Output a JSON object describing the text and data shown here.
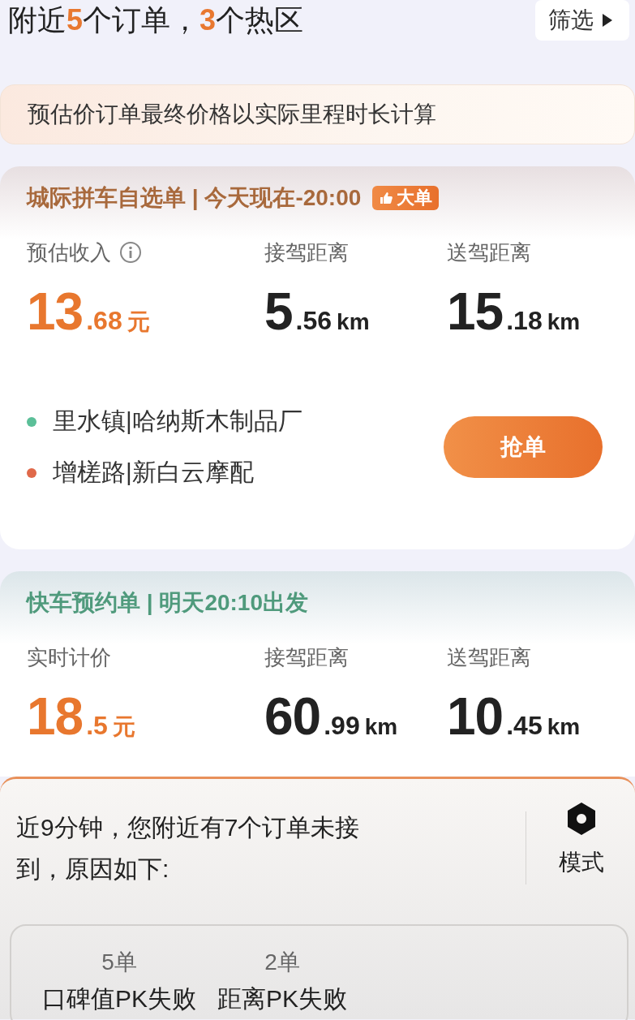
{
  "header": {
    "title_parts": [
      {
        "text": "附近",
        "highlight": false
      },
      {
        "text": "5",
        "highlight": true
      },
      {
        "text": "个订单，",
        "highlight": false
      },
      {
        "text": "3",
        "highlight": true
      },
      {
        "text": "个热区",
        "highlight": false
      }
    ],
    "filter_button": "筛选"
  },
  "notice": "预估价订单最终价格以实际里程时长计算",
  "cards": [
    {
      "title": "城际拼车自选单 | 今天现在-20:00",
      "color": "#a8693c",
      "badge": "大单",
      "stats": [
        {
          "label": "预估收入",
          "info": true,
          "accent": true,
          "integer": "13",
          "decimal": ".68",
          "unit": "元"
        },
        {
          "label": "接驾距离",
          "info": false,
          "accent": false,
          "integer": "5",
          "decimal": ".56",
          "unit": "km"
        },
        {
          "label": "送驾距离",
          "info": false,
          "accent": false,
          "integer": "15",
          "decimal": ".18",
          "unit": "km"
        }
      ],
      "stops": [
        {
          "text": "里水镇|哈纳斯木制品厂",
          "color": "#5bbf98"
        },
        {
          "text": "增槎路|新白云摩配",
          "color": "#e0694a"
        }
      ],
      "action": "抢单"
    },
    {
      "title": "快车预约单 | 明天20:10出发",
      "color": "#4f9a7c",
      "stats": [
        {
          "label": "实时计价",
          "info": false,
          "accent": true,
          "integer": "18",
          "decimal": ".5",
          "unit": "元"
        },
        {
          "label": "接驾距离",
          "info": false,
          "accent": false,
          "integer": "60",
          "decimal": ".99",
          "unit": "km"
        },
        {
          "label": "送驾距离",
          "info": false,
          "accent": false,
          "integer": "10",
          "decimal": ".45",
          "unit": "km"
        }
      ]
    }
  ],
  "missed_panel": {
    "message": "近9分钟，您附近有7个订单未接到，原因如下:",
    "mode_button": "模式",
    "reasons": [
      {
        "count": "5单",
        "label": "口碑值PK失败"
      },
      {
        "count": "2单",
        "label": "距离PK失败"
      }
    ]
  }
}
